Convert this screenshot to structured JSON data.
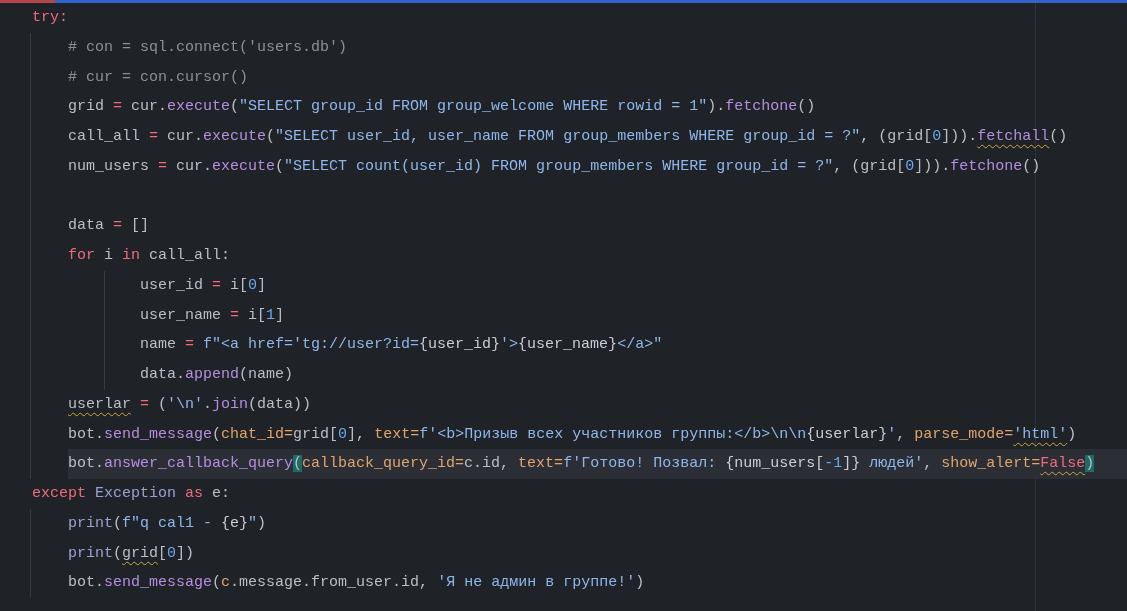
{
  "editor": {
    "lines": [
      {
        "kind": "code",
        "current": false,
        "tokens": [
          {
            "text": "try:",
            "kind": "keyword"
          }
        ],
        "children": [
          {
            "kind": "code",
            "current": false,
            "tokens": [
              {
                "text": "# con = sql.connect('users.db')",
                "kind": "comment"
              }
            ]
          },
          {
            "kind": "code",
            "current": false,
            "tokens": [
              {
                "text": "# cur = con.cursor()",
                "kind": "comment"
              }
            ]
          },
          {
            "kind": "code",
            "current": false,
            "tokens": [
              {
                "text": "grid",
                "kind": "plain"
              },
              {
                "text": " = ",
                "kind": "op"
              },
              {
                "text": "cur.",
                "kind": "plain"
              },
              {
                "text": "execute",
                "kind": "func"
              },
              {
                "text": "(",
                "kind": "plain"
              },
              {
                "text": "\"SELECT group_id FROM group_welcome WHERE rowid = 1\"",
                "kind": "string"
              },
              {
                "text": ").",
                "kind": "plain"
              },
              {
                "text": "fetchone",
                "kind": "func"
              },
              {
                "text": "()",
                "kind": "plain"
              }
            ]
          },
          {
            "kind": "code",
            "current": false,
            "tokens": [
              {
                "text": "call_all",
                "kind": "plain"
              },
              {
                "text": " = ",
                "kind": "op"
              },
              {
                "text": "cur.",
                "kind": "plain"
              },
              {
                "text": "execute",
                "kind": "func"
              },
              {
                "text": "(",
                "kind": "plain"
              },
              {
                "text": "\"SELECT user_id, user_name FROM group_members WHERE group_id = ?\"",
                "kind": "string"
              },
              {
                "text": ", (grid[",
                "kind": "plain"
              },
              {
                "text": "0",
                "kind": "number"
              },
              {
                "text": "])).",
                "kind": "plain"
              },
              {
                "text": "fetchall",
                "kind": "func",
                "warn": true
              },
              {
                "text": "()",
                "kind": "plain"
              }
            ]
          },
          {
            "kind": "code",
            "current": false,
            "tokens": [
              {
                "text": "num_users",
                "kind": "plain"
              },
              {
                "text": " = ",
                "kind": "op"
              },
              {
                "text": "cur.",
                "kind": "plain"
              },
              {
                "text": "execute",
                "kind": "func"
              },
              {
                "text": "(",
                "kind": "plain"
              },
              {
                "text": "\"SELECT count(user_id) FROM group_members WHERE group_id = ?\"",
                "kind": "string"
              },
              {
                "text": ", (grid[",
                "kind": "plain"
              },
              {
                "text": "0",
                "kind": "number"
              },
              {
                "text": "])).",
                "kind": "plain"
              },
              {
                "text": "fetchone",
                "kind": "func"
              },
              {
                "text": "()",
                "kind": "plain"
              }
            ]
          },
          {
            "kind": "blank"
          },
          {
            "kind": "code",
            "current": false,
            "tokens": [
              {
                "text": "data",
                "kind": "plain"
              },
              {
                "text": " = ",
                "kind": "op"
              },
              {
                "text": "[]",
                "kind": "plain"
              }
            ]
          },
          {
            "kind": "code",
            "current": false,
            "tokens": [
              {
                "text": "for",
                "kind": "keyword"
              },
              {
                "text": " i ",
                "kind": "plain"
              },
              {
                "text": "in",
                "kind": "keyword"
              },
              {
                "text": " call_all:",
                "kind": "plain"
              }
            ],
            "children": [
              {
                "kind": "code",
                "current": false,
                "tokens": [
                  {
                    "text": "user_id",
                    "kind": "plain"
                  },
                  {
                    "text": " = ",
                    "kind": "op"
                  },
                  {
                    "text": "i[",
                    "kind": "plain"
                  },
                  {
                    "text": "0",
                    "kind": "number"
                  },
                  {
                    "text": "]",
                    "kind": "plain"
                  }
                ]
              },
              {
                "kind": "code",
                "current": false,
                "tokens": [
                  {
                    "text": "user_name",
                    "kind": "plain"
                  },
                  {
                    "text": " = ",
                    "kind": "op"
                  },
                  {
                    "text": "i[",
                    "kind": "plain"
                  },
                  {
                    "text": "1",
                    "kind": "number"
                  },
                  {
                    "text": "]",
                    "kind": "plain"
                  }
                ]
              },
              {
                "kind": "code",
                "current": false,
                "tokens": [
                  {
                    "text": "name",
                    "kind": "plain"
                  },
                  {
                    "text": " = ",
                    "kind": "op"
                  },
                  {
                    "text": "f\"<a href='tg://user?id=",
                    "kind": "string"
                  },
                  {
                    "text": "{user_id}",
                    "kind": "interp"
                  },
                  {
                    "text": "'>",
                    "kind": "string"
                  },
                  {
                    "text": "{user_name}",
                    "kind": "interp"
                  },
                  {
                    "text": "</a>\"",
                    "kind": "string"
                  }
                ]
              },
              {
                "kind": "code",
                "current": false,
                "tokens": [
                  {
                    "text": "data.",
                    "kind": "plain"
                  },
                  {
                    "text": "append",
                    "kind": "func"
                  },
                  {
                    "text": "(name)",
                    "kind": "plain"
                  }
                ]
              }
            ]
          },
          {
            "kind": "code",
            "current": false,
            "tokens": [
              {
                "text": "userlar",
                "kind": "plain",
                "warn": true
              },
              {
                "text": " = ",
                "kind": "op"
              },
              {
                "text": "(",
                "kind": "plain"
              },
              {
                "text": "'\\n'",
                "kind": "string"
              },
              {
                "text": ".",
                "kind": "plain"
              },
              {
                "text": "join",
                "kind": "func"
              },
              {
                "text": "(data))",
                "kind": "plain"
              }
            ]
          },
          {
            "kind": "code",
            "current": false,
            "tokens": [
              {
                "text": "bot.",
                "kind": "plain"
              },
              {
                "text": "send_message",
                "kind": "func"
              },
              {
                "text": "(",
                "kind": "plain"
              },
              {
                "text": "chat_id=",
                "kind": "param"
              },
              {
                "text": "grid[",
                "kind": "plain"
              },
              {
                "text": "0",
                "kind": "number"
              },
              {
                "text": "], ",
                "kind": "plain"
              },
              {
                "text": "text=",
                "kind": "param"
              },
              {
                "text": "f'<b>Призыв всех участников группы:</b>\\n\\n",
                "kind": "string"
              },
              {
                "text": "{userlar}",
                "kind": "interp"
              },
              {
                "text": "'",
                "kind": "string"
              },
              {
                "text": ", ",
                "kind": "plain"
              },
              {
                "text": "parse_mode=",
                "kind": "param"
              },
              {
                "text": "'html'",
                "kind": "string",
                "warn": true
              },
              {
                "text": ")",
                "kind": "plain"
              }
            ]
          },
          {
            "kind": "code",
            "current": true,
            "tokens": [
              {
                "text": "bot.",
                "kind": "plain"
              },
              {
                "text": "answer_callback_query",
                "kind": "func"
              },
              {
                "text": "(",
                "kind": "plain",
                "match": true
              },
              {
                "text": "callback_query_id=",
                "kind": "param"
              },
              {
                "text": "c.id, ",
                "kind": "plain"
              },
              {
                "text": "text=",
                "kind": "param"
              },
              {
                "text": "f'Готово! Позвал: ",
                "kind": "string"
              },
              {
                "text": "{num_users[",
                "kind": "interp"
              },
              {
                "text": "-1",
                "kind": "number"
              },
              {
                "text": "]}",
                "kind": "interp"
              },
              {
                "text": " людей'",
                "kind": "string"
              },
              {
                "text": ", ",
                "kind": "plain"
              },
              {
                "text": "show_alert=",
                "kind": "param"
              },
              {
                "text": "False",
                "kind": "bool",
                "warn": true
              },
              {
                "text": ")",
                "kind": "plain",
                "match": true
              }
            ]
          }
        ]
      },
      {
        "kind": "code",
        "current": false,
        "tokens": [
          {
            "text": "except ",
            "kind": "keyword"
          },
          {
            "text": "Exception ",
            "kind": "class"
          },
          {
            "text": "as",
            "kind": "keyword"
          },
          {
            "text": " e:",
            "kind": "plain"
          }
        ],
        "children": [
          {
            "kind": "code",
            "current": false,
            "tokens": [
              {
                "text": "print",
                "kind": "builtin"
              },
              {
                "text": "(",
                "kind": "plain"
              },
              {
                "text": "f\"q cal1 - ",
                "kind": "string"
              },
              {
                "text": "{e}",
                "kind": "interp"
              },
              {
                "text": "\"",
                "kind": "string"
              },
              {
                "text": ")",
                "kind": "plain"
              }
            ]
          },
          {
            "kind": "code",
            "current": false,
            "tokens": [
              {
                "text": "print",
                "kind": "builtin"
              },
              {
                "text": "(",
                "kind": "plain"
              },
              {
                "text": "grid",
                "kind": "plain",
                "warn": true
              },
              {
                "text": "[",
                "kind": "plain"
              },
              {
                "text": "0",
                "kind": "number"
              },
              {
                "text": "])",
                "kind": "plain"
              }
            ]
          },
          {
            "kind": "code",
            "current": false,
            "tokens": [
              {
                "text": "bot.",
                "kind": "plain"
              },
              {
                "text": "send_message",
                "kind": "func"
              },
              {
                "text": "(",
                "kind": "plain"
              },
              {
                "text": "c",
                "kind": "param"
              },
              {
                "text": ".message.from_user.id, ",
                "kind": "plain"
              },
              {
                "text": "'Я не админ в группе!'",
                "kind": "string"
              },
              {
                "text": ")",
                "kind": "plain"
              }
            ]
          }
        ]
      }
    ]
  }
}
